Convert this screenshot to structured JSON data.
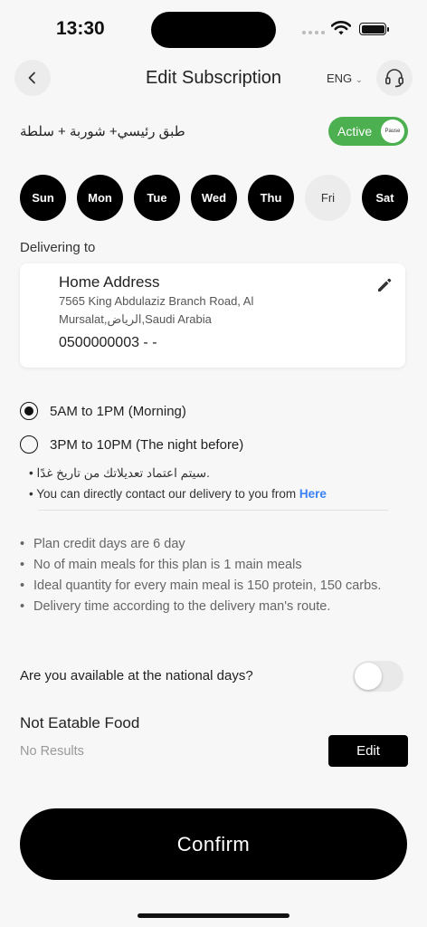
{
  "status_bar": {
    "time": "13:30"
  },
  "header": {
    "title": "Edit Subscription",
    "language": "ENG"
  },
  "subscription": {
    "meal_name": "طبق رئيسي+ شوربة + سلطة",
    "status_label": "Active",
    "pause_label": "Pause"
  },
  "days": [
    {
      "label": "Sun",
      "selected": true
    },
    {
      "label": "Mon",
      "selected": true
    },
    {
      "label": "Tue",
      "selected": true
    },
    {
      "label": "Wed",
      "selected": true
    },
    {
      "label": "Thu",
      "selected": true
    },
    {
      "label": "Fri",
      "selected": false
    },
    {
      "label": "Sat",
      "selected": true
    }
  ],
  "delivery": {
    "label": "Delivering to",
    "address_title": "Home Address",
    "address_line1": "7565 King Abdulaziz Branch Road, Al",
    "address_line2": "Mursalat,الرياض,Saudi Arabia",
    "phone": "0500000003 - -"
  },
  "time_slots": [
    {
      "label": "5AM to 1PM (Morning)",
      "selected": true
    },
    {
      "label": "3PM to 10PM (The night before)",
      "selected": false
    }
  ],
  "notes": {
    "note1": "• سيتم اعتماد تعديلاتك من تاريخ غدًا.",
    "note2_prefix": "• You can directly contact our delivery to you from ",
    "note2_link": "Here"
  },
  "plan_info": [
    "Plan credit days are  6 day",
    "No of main meals for this plan is 1 main meals",
    "Ideal quantity for every main meal is 150 protein, 150 carbs.",
    "Delivery time according to the delivery man's route."
  ],
  "national_days": {
    "label": "Are you available at the national days?",
    "enabled": false
  },
  "not_eatable": {
    "title": "Not Eatable Food",
    "empty_text": "No Results",
    "edit_label": "Edit"
  },
  "confirm_label": "Confirm",
  "colors": {
    "active_green": "#4caf50",
    "link_blue": "#3b82f6",
    "primary": "#000000"
  }
}
